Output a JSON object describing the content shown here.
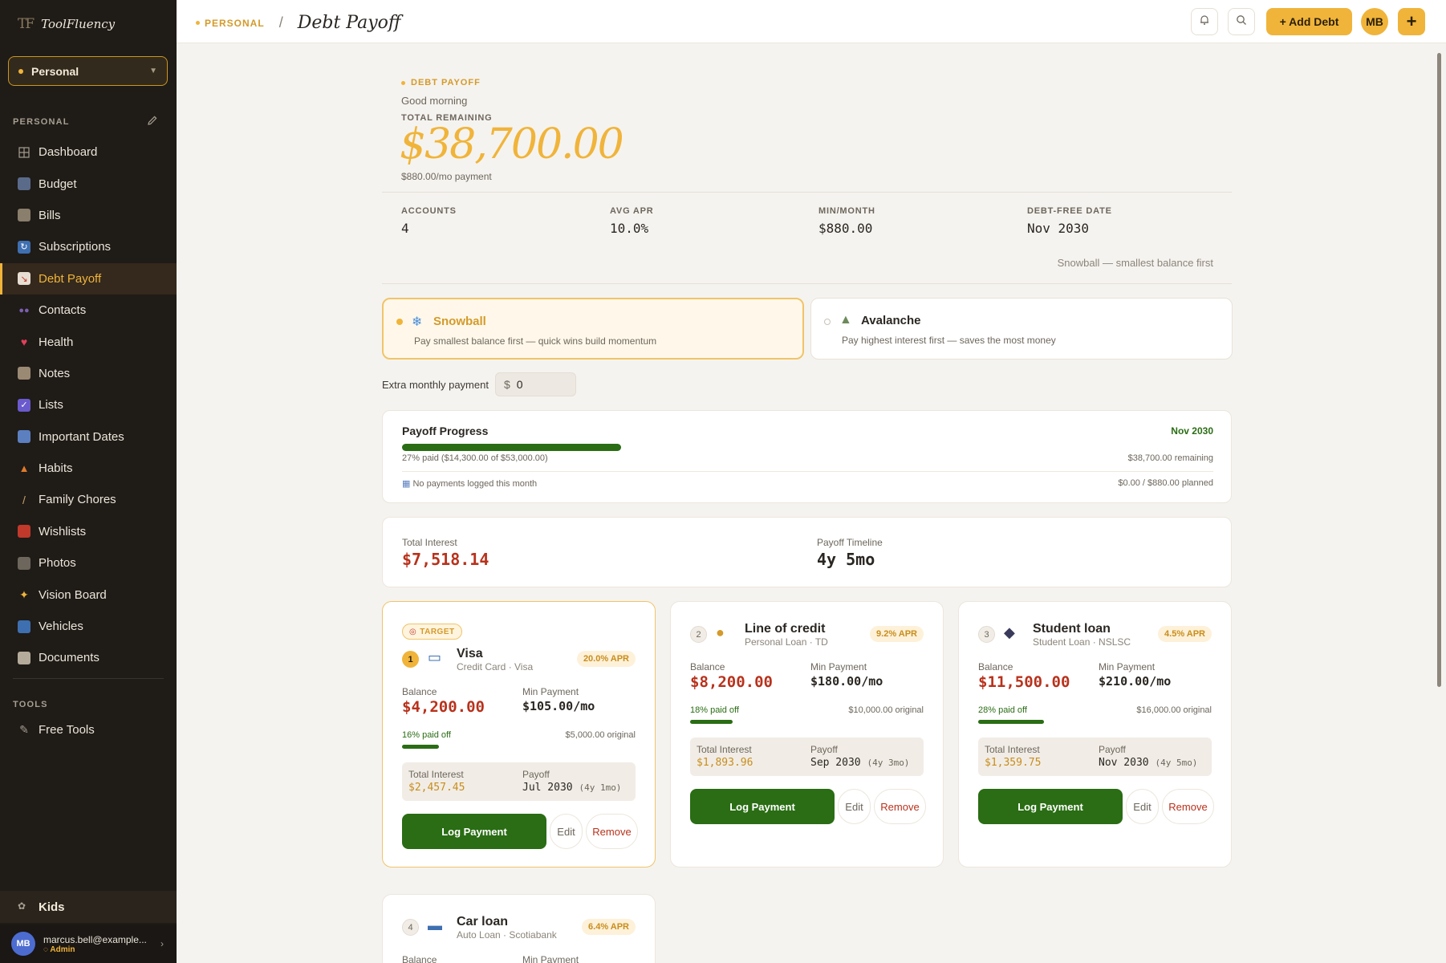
{
  "app": {
    "brand_mark": "TF",
    "brand_name": "ToolFluency"
  },
  "workspace": {
    "selected": "Personal"
  },
  "sidebar": {
    "section_label": "PERSONAL",
    "items": [
      {
        "label": "Dashboard",
        "icon": "grid-icon"
      },
      {
        "label": "Budget",
        "icon": "bar-chart-icon"
      },
      {
        "label": "Bills",
        "icon": "receipt-icon"
      },
      {
        "label": "Subscriptions",
        "icon": "refresh-icon"
      },
      {
        "label": "Debt Payoff",
        "icon": "trend-down-icon"
      },
      {
        "label": "Contacts",
        "icon": "people-icon"
      },
      {
        "label": "Health",
        "icon": "heart-icon"
      },
      {
        "label": "Notes",
        "icon": "note-icon"
      },
      {
        "label": "Lists",
        "icon": "checkbox-icon"
      },
      {
        "label": "Important Dates",
        "icon": "calendar-icon"
      },
      {
        "label": "Habits",
        "icon": "flame-icon"
      },
      {
        "label": "Family Chores",
        "icon": "broom-icon"
      },
      {
        "label": "Wishlists",
        "icon": "gift-icon"
      },
      {
        "label": "Photos",
        "icon": "camera-icon"
      },
      {
        "label": "Vision Board",
        "icon": "sparkle-icon"
      },
      {
        "label": "Vehicles",
        "icon": "car-icon"
      },
      {
        "label": "Documents",
        "icon": "document-icon"
      }
    ],
    "tools_label": "TOOLS",
    "tools_item": "Free Tools",
    "kids_label": "Kids",
    "user": {
      "initials": "MB",
      "email": "marcus.bell@example...",
      "role": "Admin"
    }
  },
  "topbar": {
    "breadcrumb_ws": "PERSONAL",
    "breadcrumb_sep": "/",
    "title": "Debt Payoff",
    "add_debt": "+ Add Debt",
    "avatar": "MB",
    "plus": "+"
  },
  "hero": {
    "tag": "DEBT PAYOFF",
    "greeting": "Good morning",
    "total_label": "TOTAL REMAINING",
    "total": "$38,700.00",
    "monthly": "$880.00/mo payment"
  },
  "stats": [
    {
      "label": "ACCOUNTS",
      "value": "4"
    },
    {
      "label": "AVG APR",
      "value": "10.0%"
    },
    {
      "label": "MIN/MONTH",
      "value": "$880.00"
    },
    {
      "label": "DEBT-FREE DATE",
      "value": "Nov 2030"
    }
  ],
  "strategy_note": "Snowball — smallest balance first",
  "strategies": [
    {
      "name": "Snowball",
      "icon": "snowflake-icon",
      "desc": "Pay smallest balance first — quick wins build momentum",
      "active": true
    },
    {
      "name": "Avalanche",
      "icon": "mountain-icon",
      "desc": "Pay highest interest first — saves the most money",
      "active": false
    }
  ],
  "extra": {
    "label": "Extra monthly payment",
    "currency": "$",
    "value": "0"
  },
  "progress": {
    "title": "Payoff Progress",
    "date": "Nov 2030",
    "percent_paid": 27,
    "paid_text": "27% paid ($14,300.00 of $53,000.00)",
    "remaining_text": "$38,700.00 remaining",
    "log_text": "No payments logged this month",
    "planned_text": "$0.00 / $880.00 planned"
  },
  "totals": {
    "interest_label": "Total Interest",
    "interest": "$7,518.14",
    "timeline_label": "Payoff Timeline",
    "timeline": "4y 5mo"
  },
  "labels": {
    "balance": "Balance",
    "min_payment": "Min Payment",
    "total_interest": "Total Interest",
    "payoff": "Payoff",
    "log_payment": "Log Payment",
    "edit": "Edit",
    "remove": "Remove",
    "target": "TARGET"
  },
  "debts": [
    {
      "rank": "1",
      "name": "Visa",
      "sub": "Credit Card · Visa",
      "icon": "credit-card-icon",
      "apr": "20.0% APR",
      "balance": "$4,200.00",
      "min": "$105.00/mo",
      "paid_text": "16% paid off",
      "paid_pct": 16,
      "original": "$5,000.00 original",
      "interest": "$2,457.45",
      "payoff": "Jul 2030",
      "payoff_span": "(4y 1mo)"
    },
    {
      "rank": "2",
      "name": "Line of credit",
      "sub": "Personal Loan · TD",
      "icon": "money-bag-icon",
      "apr": "9.2% APR",
      "balance": "$8,200.00",
      "min": "$180.00/mo",
      "paid_text": "18% paid off",
      "paid_pct": 18,
      "original": "$10,000.00 original",
      "interest": "$1,893.96",
      "payoff": "Sep 2030",
      "payoff_span": "(4y 3mo)"
    },
    {
      "rank": "3",
      "name": "Student loan",
      "sub": "Student Loan · NSLSC",
      "icon": "graduation-cap-icon",
      "apr": "4.5% APR",
      "balance": "$11,500.00",
      "min": "$210.00/mo",
      "paid_text": "28% paid off",
      "paid_pct": 28,
      "original": "$16,000.00 original",
      "interest": "$1,359.75",
      "payoff": "Nov 2030",
      "payoff_span": "(4y 5mo)"
    },
    {
      "rank": "4",
      "name": "Car loan",
      "sub": "Auto Loan · Scotiabank",
      "icon": "car-icon",
      "apr": "6.4% APR"
    }
  ],
  "colors": {
    "accent": "#f0b43a",
    "sidebar": "#1f1b17",
    "success": "#2a6d14",
    "danger": "#b8321c"
  }
}
